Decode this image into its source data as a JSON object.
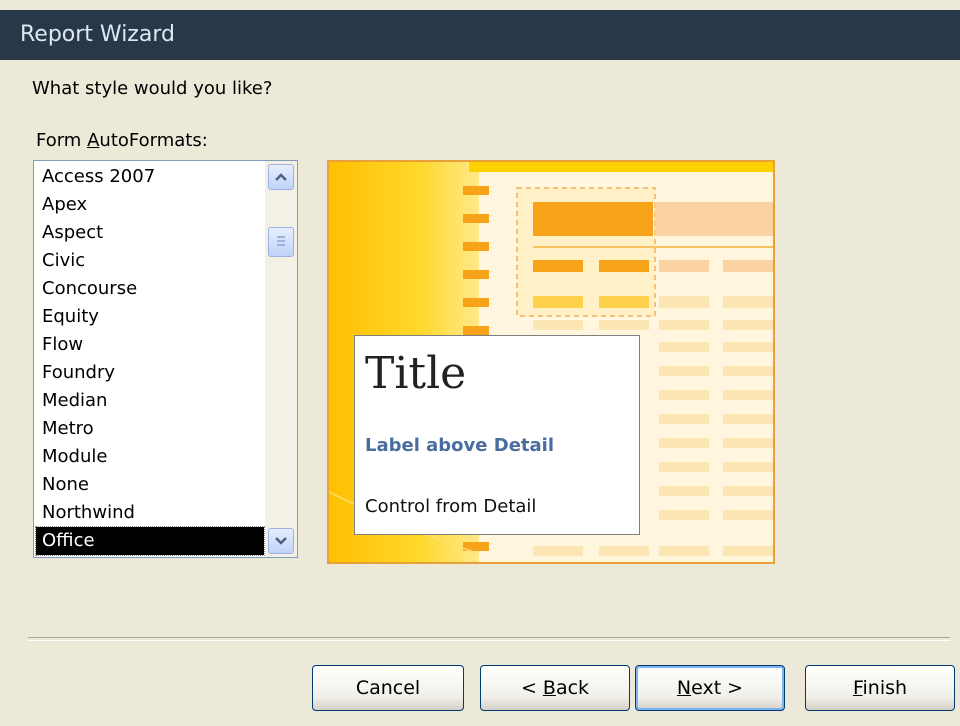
{
  "window": {
    "title": "Report Wizard"
  },
  "prompt": {
    "question": "What style would you like?"
  },
  "autoformats": {
    "label_prefix": "Form ",
    "label_accel": "A",
    "label_rest": "utoFormats:",
    "items": [
      "Access 2007",
      "Apex",
      "Aspect",
      "Civic",
      "Concourse",
      "Equity",
      "Flow",
      "Foundry",
      "Median",
      "Metro",
      "Module",
      "None",
      "Northwind",
      "Office"
    ],
    "selected": "Office"
  },
  "preview": {
    "title": "Title",
    "label": "Label above Detail",
    "control": "Control from Detail"
  },
  "buttons": {
    "cancel": "Cancel",
    "back_prefix": "< ",
    "back_accel": "B",
    "back_rest": "ack",
    "next_accel": "N",
    "next_rest": "ext >",
    "finish_accel": "F",
    "finish_rest": "inish"
  },
  "colors": {
    "accent": "#e8a13a",
    "titlebar": "#283849",
    "selection": "#000000"
  }
}
